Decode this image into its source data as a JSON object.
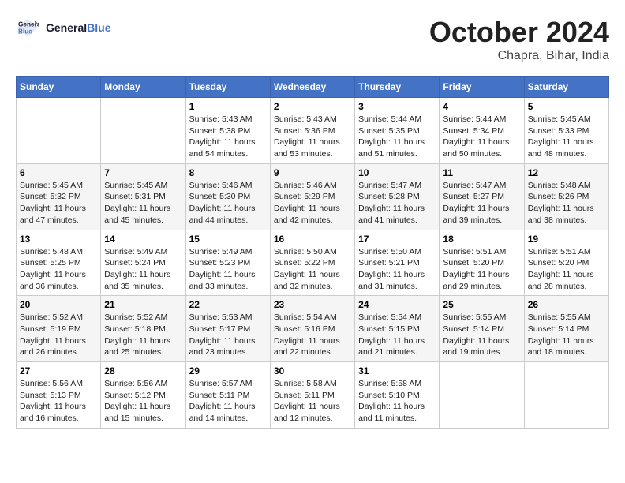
{
  "header": {
    "logo_line1": "General",
    "logo_line2": "Blue",
    "month": "October 2024",
    "location": "Chapra, Bihar, India"
  },
  "weekdays": [
    "Sunday",
    "Monday",
    "Tuesday",
    "Wednesday",
    "Thursday",
    "Friday",
    "Saturday"
  ],
  "weeks": [
    [
      {
        "day": "",
        "info": ""
      },
      {
        "day": "",
        "info": ""
      },
      {
        "day": "1",
        "info": "Sunrise: 5:43 AM\nSunset: 5:38 PM\nDaylight: 11 hours and 54 minutes."
      },
      {
        "day": "2",
        "info": "Sunrise: 5:43 AM\nSunset: 5:36 PM\nDaylight: 11 hours and 53 minutes."
      },
      {
        "day": "3",
        "info": "Sunrise: 5:44 AM\nSunset: 5:35 PM\nDaylight: 11 hours and 51 minutes."
      },
      {
        "day": "4",
        "info": "Sunrise: 5:44 AM\nSunset: 5:34 PM\nDaylight: 11 hours and 50 minutes."
      },
      {
        "day": "5",
        "info": "Sunrise: 5:45 AM\nSunset: 5:33 PM\nDaylight: 11 hours and 48 minutes."
      }
    ],
    [
      {
        "day": "6",
        "info": "Sunrise: 5:45 AM\nSunset: 5:32 PM\nDaylight: 11 hours and 47 minutes."
      },
      {
        "day": "7",
        "info": "Sunrise: 5:45 AM\nSunset: 5:31 PM\nDaylight: 11 hours and 45 minutes."
      },
      {
        "day": "8",
        "info": "Sunrise: 5:46 AM\nSunset: 5:30 PM\nDaylight: 11 hours and 44 minutes."
      },
      {
        "day": "9",
        "info": "Sunrise: 5:46 AM\nSunset: 5:29 PM\nDaylight: 11 hours and 42 minutes."
      },
      {
        "day": "10",
        "info": "Sunrise: 5:47 AM\nSunset: 5:28 PM\nDaylight: 11 hours and 41 minutes."
      },
      {
        "day": "11",
        "info": "Sunrise: 5:47 AM\nSunset: 5:27 PM\nDaylight: 11 hours and 39 minutes."
      },
      {
        "day": "12",
        "info": "Sunrise: 5:48 AM\nSunset: 5:26 PM\nDaylight: 11 hours and 38 minutes."
      }
    ],
    [
      {
        "day": "13",
        "info": "Sunrise: 5:48 AM\nSunset: 5:25 PM\nDaylight: 11 hours and 36 minutes."
      },
      {
        "day": "14",
        "info": "Sunrise: 5:49 AM\nSunset: 5:24 PM\nDaylight: 11 hours and 35 minutes."
      },
      {
        "day": "15",
        "info": "Sunrise: 5:49 AM\nSunset: 5:23 PM\nDaylight: 11 hours and 33 minutes."
      },
      {
        "day": "16",
        "info": "Sunrise: 5:50 AM\nSunset: 5:22 PM\nDaylight: 11 hours and 32 minutes."
      },
      {
        "day": "17",
        "info": "Sunrise: 5:50 AM\nSunset: 5:21 PM\nDaylight: 11 hours and 31 minutes."
      },
      {
        "day": "18",
        "info": "Sunrise: 5:51 AM\nSunset: 5:20 PM\nDaylight: 11 hours and 29 minutes."
      },
      {
        "day": "19",
        "info": "Sunrise: 5:51 AM\nSunset: 5:20 PM\nDaylight: 11 hours and 28 minutes."
      }
    ],
    [
      {
        "day": "20",
        "info": "Sunrise: 5:52 AM\nSunset: 5:19 PM\nDaylight: 11 hours and 26 minutes."
      },
      {
        "day": "21",
        "info": "Sunrise: 5:52 AM\nSunset: 5:18 PM\nDaylight: 11 hours and 25 minutes."
      },
      {
        "day": "22",
        "info": "Sunrise: 5:53 AM\nSunset: 5:17 PM\nDaylight: 11 hours and 23 minutes."
      },
      {
        "day": "23",
        "info": "Sunrise: 5:54 AM\nSunset: 5:16 PM\nDaylight: 11 hours and 22 minutes."
      },
      {
        "day": "24",
        "info": "Sunrise: 5:54 AM\nSunset: 5:15 PM\nDaylight: 11 hours and 21 minutes."
      },
      {
        "day": "25",
        "info": "Sunrise: 5:55 AM\nSunset: 5:14 PM\nDaylight: 11 hours and 19 minutes."
      },
      {
        "day": "26",
        "info": "Sunrise: 5:55 AM\nSunset: 5:14 PM\nDaylight: 11 hours and 18 minutes."
      }
    ],
    [
      {
        "day": "27",
        "info": "Sunrise: 5:56 AM\nSunset: 5:13 PM\nDaylight: 11 hours and 16 minutes."
      },
      {
        "day": "28",
        "info": "Sunrise: 5:56 AM\nSunset: 5:12 PM\nDaylight: 11 hours and 15 minutes."
      },
      {
        "day": "29",
        "info": "Sunrise: 5:57 AM\nSunset: 5:11 PM\nDaylight: 11 hours and 14 minutes."
      },
      {
        "day": "30",
        "info": "Sunrise: 5:58 AM\nSunset: 5:11 PM\nDaylight: 11 hours and 12 minutes."
      },
      {
        "day": "31",
        "info": "Sunrise: 5:58 AM\nSunset: 5:10 PM\nDaylight: 11 hours and 11 minutes."
      },
      {
        "day": "",
        "info": ""
      },
      {
        "day": "",
        "info": ""
      }
    ]
  ]
}
